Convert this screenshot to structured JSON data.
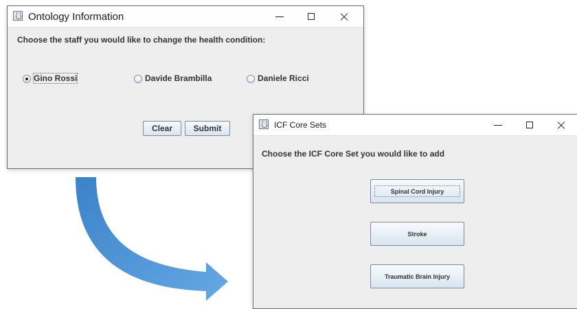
{
  "ontology_window": {
    "title": "Ontology Information",
    "prompt": "Choose the staff you would like to change the health condition:",
    "staff_options": [
      {
        "label": "Gino Rossi",
        "selected": true
      },
      {
        "label": "Davide Brambilla",
        "selected": false
      },
      {
        "label": "Daniele Ricci",
        "selected": false
      }
    ],
    "clear_label": "Clear",
    "submit_label": "Submit"
  },
  "icf_window": {
    "title": "ICF Core Sets",
    "prompt": "Choose the ICF Core Set you would like to add",
    "options": [
      "Spinal Cord Injury",
      "Stroke",
      "Traumatic Brain Injury"
    ]
  },
  "colors": {
    "window_bg": "#eeeeee",
    "titlebar_bg": "#ffffff",
    "arrow": "#4a90d2"
  },
  "icons": {
    "app_icon": "java-cup-icon",
    "minimize": "minimize-icon",
    "maximize": "maximize-icon",
    "close": "close-icon",
    "flow_arrow": "curved-arrow-icon"
  }
}
